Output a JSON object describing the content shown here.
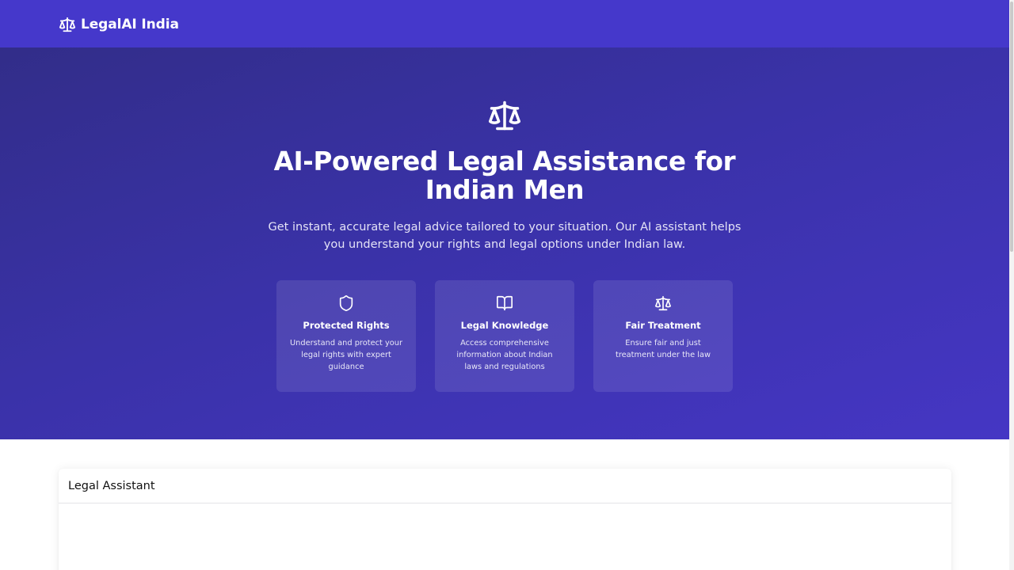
{
  "navbar": {
    "brand": "LegalAI India",
    "brand_icon": "scale-icon",
    "background": "#4538cb"
  },
  "hero": {
    "icon": "scale-icon",
    "title": "AI-Powered Legal Assistance for Indian Men",
    "subtitle": "Get instant, accurate legal advice tailored to your situation. Our AI assistant helps you understand your rights and legal options under Indian law.",
    "gradient": [
      "#322d89",
      "#4536c4"
    ]
  },
  "features": [
    {
      "icon": "shield-icon",
      "title": "Protected Rights",
      "description": "Understand and protect your legal rights with expert guidance"
    },
    {
      "icon": "book-open-icon",
      "title": "Legal Knowledge",
      "description": "Access comprehensive information about Indian laws and regulations"
    },
    {
      "icon": "scale-icon",
      "title": "Fair Treatment",
      "description": "Ensure fair and just treatment under the law"
    }
  ],
  "assistant_panel": {
    "title": "Legal Assistant"
  }
}
